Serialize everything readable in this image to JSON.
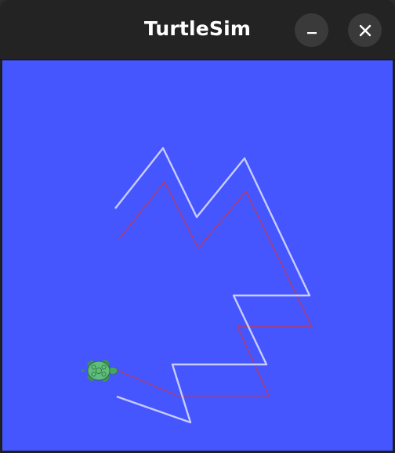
{
  "window": {
    "title": "TurtleSim"
  },
  "titlebar_buttons": {
    "minimize_icon": "minimize-icon",
    "close_icon": "close-icon"
  },
  "canvas": {
    "background": "#4556ff",
    "trail_colors": {
      "light": "#c9ccff",
      "red": "#c8374f"
    },
    "turtle_icon": "turtle-icon",
    "turtle_color": "#5fbf7a"
  }
}
